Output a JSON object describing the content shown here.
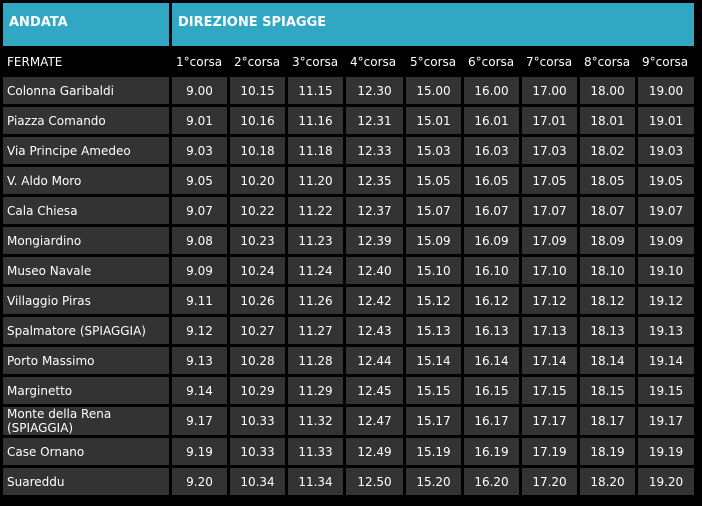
{
  "header": {
    "left": "ANDATA",
    "right": "DIREZIONE SPIAGGE"
  },
  "columns": [
    "FERMATE",
    "1°corsa",
    "2°corsa",
    "3°corsa",
    "4°corsa",
    "5°corsa",
    "6°corsa",
    "7°corsa",
    "8°corsa",
    "9°corsa"
  ],
  "rows": [
    [
      "Colonna Garibaldi",
      "9.00",
      "10.15",
      "11.15",
      "12.30",
      "15.00",
      "16.00",
      "17.00",
      "18.00",
      "19.00"
    ],
    [
      "Piazza Comando",
      "9.01",
      "10.16",
      "11.16",
      "12.31",
      "15.01",
      "16.01",
      "17.01",
      "18.01",
      "19.01"
    ],
    [
      "Via Principe Amedeo",
      "9.03",
      "10.18",
      "11.18",
      "12.33",
      "15.03",
      "16.03",
      "17.03",
      "18.02",
      "19.03"
    ],
    [
      "V. Aldo Moro",
      "9.05",
      "10.20",
      "11.20",
      "12.35",
      "15.05",
      "16.05",
      "17.05",
      "18.05",
      "19.05"
    ],
    [
      "Cala Chiesa",
      "9.07",
      "10.22",
      "11.22",
      "12.37",
      "15.07",
      "16.07",
      "17.07",
      "18.07",
      "19.07"
    ],
    [
      "Mongiardino",
      "9.08",
      "10.23",
      "11.23",
      "12.39",
      "15.09",
      "16.09",
      "17.09",
      "18.09",
      "19.09"
    ],
    [
      "Museo Navale",
      "9.09",
      "10.24",
      "11.24",
      "12.40",
      "15.10",
      "16.10",
      "17.10",
      "18.10",
      "19.10"
    ],
    [
      "Villaggio Piras",
      "9.11",
      "10.26",
      "11.26",
      "12.42",
      "15.12",
      "16.12",
      "17.12",
      "18.12",
      "19.12"
    ],
    [
      "Spalmatore (SPIAGGIA)",
      "9.12",
      "10.27",
      "11.27",
      "12.43",
      "15.13",
      "16.13",
      "17.13",
      "18.13",
      "19.13"
    ],
    [
      "Porto Massimo",
      "9.13",
      "10.28",
      "11.28",
      "12.44",
      "15.14",
      "16.14",
      "17.14",
      "18.14",
      "19.14"
    ],
    [
      "Marginetto",
      "9.14",
      "10.29",
      "11.29",
      "12.45",
      "15.15",
      "16.15",
      "17.15",
      "18.15",
      "19.15"
    ],
    [
      "Monte della Rena (SPIAGGIA)",
      "9.17",
      "10.33",
      "11.32",
      "12.47",
      "15.17",
      "16.17",
      "17.17",
      "18.17",
      "19.17"
    ],
    [
      "Case Ornano",
      "9.19",
      "10.33",
      "11.33",
      "12.49",
      "15.19",
      "16.19",
      "17.19",
      "18.19",
      "19.19"
    ],
    [
      "Suareddu",
      "9.20",
      "10.34",
      "11.34",
      "12.50",
      "15.20",
      "16.20",
      "17.20",
      "18.20",
      "19.20"
    ]
  ],
  "colors": {
    "header_bg": "#30a8c4",
    "row_bg": "#333333",
    "page_bg": "#000000",
    "text": "#ffffff"
  }
}
